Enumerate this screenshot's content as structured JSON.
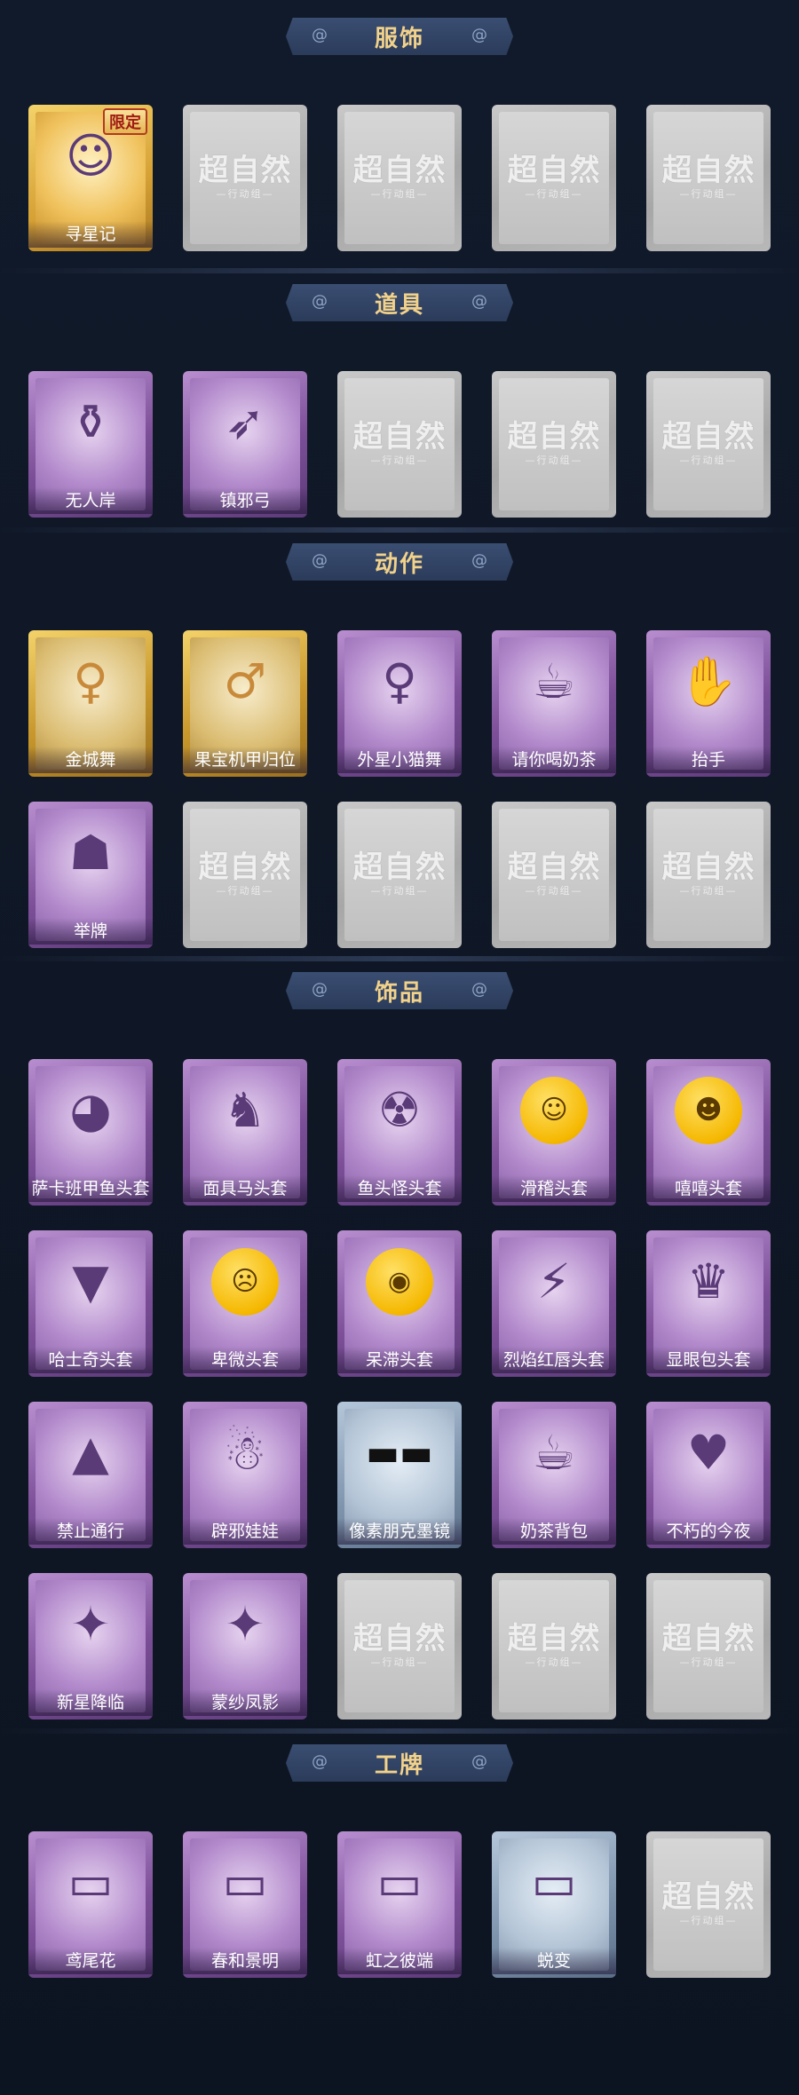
{
  "sections": [
    {
      "title": "服饰",
      "items": [
        {
          "label": "寻星记",
          "type": "outfit",
          "badge": "限定",
          "icon": "character-avatar-icon"
        },
        {
          "label": "",
          "type": "gray"
        },
        {
          "label": "",
          "type": "gray"
        },
        {
          "label": "",
          "type": "gray"
        },
        {
          "label": "",
          "type": "gray"
        }
      ]
    },
    {
      "title": "道具",
      "items": [
        {
          "label": "无人岸",
          "type": "purple",
          "icon": "potion-bottle-icon"
        },
        {
          "label": "镇邪弓",
          "type": "purple",
          "icon": "bow-icon"
        },
        {
          "label": "",
          "type": "gray"
        },
        {
          "label": "",
          "type": "gray"
        },
        {
          "label": "",
          "type": "gray"
        }
      ]
    },
    {
      "title": "动作",
      "items": [
        {
          "label": "金城舞",
          "type": "gold",
          "icon": "dance-pose-icon"
        },
        {
          "label": "果宝机甲归位",
          "type": "gold",
          "icon": "pose-icon"
        },
        {
          "label": "外星小猫舞",
          "type": "purple",
          "icon": "dance-pose-icon"
        },
        {
          "label": "请你喝奶茶",
          "type": "purple",
          "icon": "milk-tea-pose-icon"
        },
        {
          "label": "抬手",
          "type": "purple",
          "icon": "raise-hand-icon"
        },
        {
          "label": "举牌",
          "type": "purple",
          "icon": "hold-sign-icon"
        },
        {
          "label": "",
          "type": "gray"
        },
        {
          "label": "",
          "type": "gray"
        },
        {
          "label": "",
          "type": "gray"
        },
        {
          "label": "",
          "type": "gray"
        }
      ]
    },
    {
      "title": "饰品",
      "items": [
        {
          "label": "萨卡班甲鱼头套",
          "type": "purple",
          "icon": "fish-head-icon"
        },
        {
          "label": "面具马头套",
          "type": "purple",
          "icon": "horse-head-icon"
        },
        {
          "label": "鱼头怪头套",
          "type": "purple",
          "icon": "fish-monster-head-icon"
        },
        {
          "label": "滑稽头套",
          "type": "purple",
          "icon": "funny-face-icon"
        },
        {
          "label": "嘻嘻头套",
          "type": "purple",
          "icon": "grin-face-icon"
        },
        {
          "label": "哈士奇头套",
          "type": "purple",
          "icon": "husky-head-icon"
        },
        {
          "label": "卑微头套",
          "type": "purple",
          "icon": "humble-face-icon"
        },
        {
          "label": "呆滞头套",
          "type": "purple",
          "icon": "dazed-face-icon"
        },
        {
          "label": "烈焰红唇头套",
          "type": "purple",
          "icon": "pikachu-head-icon"
        },
        {
          "label": "显眼包头套",
          "type": "purple",
          "icon": "crown-bulb-head-icon"
        },
        {
          "label": "禁止通行",
          "type": "purple",
          "icon": "traffic-cone-icon"
        },
        {
          "label": "辟邪娃娃",
          "type": "purple",
          "icon": "doll-icon"
        },
        {
          "label": "像素朋克墨镜",
          "type": "blue",
          "icon": "pixel-sunglasses-icon"
        },
        {
          "label": "奶茶背包",
          "type": "purple",
          "icon": "milk-tea-backpack-icon"
        },
        {
          "label": "不朽的今夜",
          "type": "purple",
          "icon": "pink-cat-icon"
        },
        {
          "label": "新星降临",
          "type": "purple",
          "icon": "keychain-doll-icon"
        },
        {
          "label": "蒙纱凤影",
          "type": "purple",
          "icon": "keychain-doll-icon"
        },
        {
          "label": "",
          "type": "gray"
        },
        {
          "label": "",
          "type": "gray"
        },
        {
          "label": "",
          "type": "gray"
        }
      ]
    },
    {
      "title": "工牌",
      "items": [
        {
          "label": "鸢尾花",
          "type": "purple",
          "icon": "badge-card-icon"
        },
        {
          "label": "春和景明",
          "type": "purple",
          "icon": "badge-card-icon"
        },
        {
          "label": "虹之彼端",
          "type": "purple",
          "icon": "badge-card-icon"
        },
        {
          "label": "蜕变",
          "type": "blue",
          "icon": "badge-card-icon"
        },
        {
          "label": "",
          "type": "gray"
        }
      ]
    }
  ],
  "placeholder": {
    "watermark": "超自然",
    "subtitle": "—行动组—"
  }
}
